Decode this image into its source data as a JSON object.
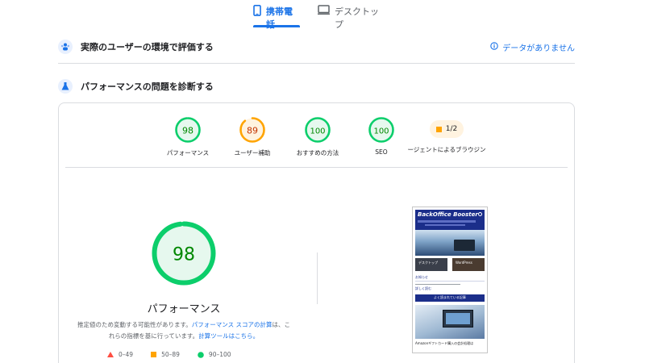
{
  "device_tabs": [
    {
      "label": "携帯電話",
      "icon": "mobile-phone-icon",
      "active": true
    },
    {
      "label": "デスクトップ",
      "icon": "desktop-icon",
      "active": false
    }
  ],
  "field_section": {
    "title": "実際のユーザーの環境で評価する",
    "icon": "users-icon",
    "no_data": "データがありません",
    "no_data_icon": "info-icon"
  },
  "lab_section": {
    "title": "パフォーマンスの問題を診断する",
    "icon": "lab-flask-icon"
  },
  "gauges": [
    {
      "score": 98,
      "label": "パフォーマンス",
      "color": "#0cce6b",
      "fill": "#e6f8ee",
      "text_color": "#008800"
    },
    {
      "score": 89,
      "label": "ユーザー補助",
      "color": "#ffa400",
      "fill": "#fff3e0",
      "text_color": "#c33300"
    },
    {
      "score": 100,
      "label": "おすすめの方法",
      "color": "#0cce6b",
      "fill": "#e6f8ee",
      "text_color": "#008800"
    },
    {
      "score": 100,
      "label": "SEO",
      "color": "#0cce6b",
      "fill": "#e6f8ee",
      "text_color": "#008800"
    }
  ],
  "pwa": {
    "value": "1/2",
    "label": "ージェントによるブラウジン"
  },
  "performance": {
    "score": 98,
    "label": "パフォーマンス",
    "desc_1": "推定値のため変動する可能性があります。",
    "desc_link_1": "パフォーマンス スコアの計算",
    "desc_2": "は、これらの指標を基に行っています。",
    "desc_link_2": "計算ツールはこちら。"
  },
  "legend": [
    {
      "range": "0–49",
      "shape": "triangle",
      "color": "#ff4e42"
    },
    {
      "range": "50–89",
      "shape": "square",
      "color": "#ffa400"
    },
    {
      "range": "90–100",
      "shape": "circle",
      "color": "#0cce6b"
    }
  ],
  "thumbnail": {
    "site_title": "BackOffice Booster",
    "card_1": "デスクトップ",
    "card_2": "WordPress",
    "notice": "お知らせ",
    "read_link": "詳しく読む",
    "button": "よく読まれている記事",
    "caption": "Amazonギフトカード購入の会計処理は"
  }
}
